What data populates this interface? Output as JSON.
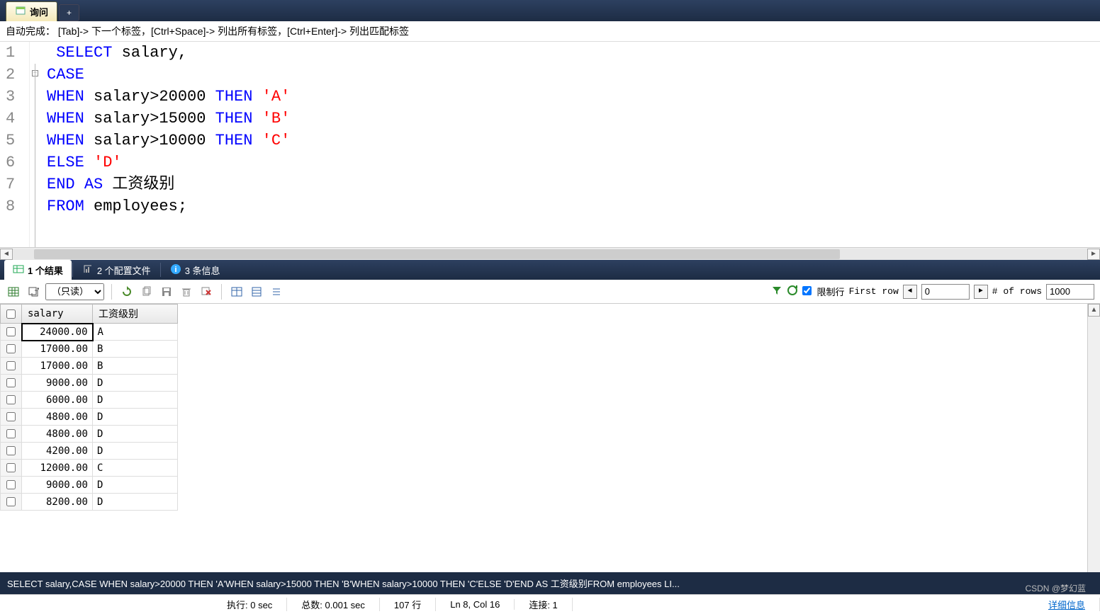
{
  "tabs": {
    "main": "询问",
    "plus": "+"
  },
  "hint": "自动完成：  [Tab]-> 下一个标签，[Ctrl+Space]-> 列出所有标签，[Ctrl+Enter]-> 列出匹配标签",
  "code": {
    "lines": [
      "1",
      "2",
      "3",
      "4",
      "5",
      "6",
      "7",
      "8"
    ],
    "tokens": [
      [
        {
          "t": "SELECT",
          "c": "kw"
        },
        {
          "t": " salary,",
          "c": "ident"
        }
      ],
      [
        {
          "t": "CASE",
          "c": "kw"
        }
      ],
      [
        {
          "t": "WHEN",
          "c": "kw"
        },
        {
          "t": " salary>20000 ",
          "c": "ident"
        },
        {
          "t": "THEN",
          "c": "kw"
        },
        {
          "t": " ",
          "c": "ident"
        },
        {
          "t": "'A'",
          "c": "str"
        }
      ],
      [
        {
          "t": "WHEN",
          "c": "kw"
        },
        {
          "t": " salary>15000 ",
          "c": "ident"
        },
        {
          "t": "THEN",
          "c": "kw"
        },
        {
          "t": " ",
          "c": "ident"
        },
        {
          "t": "'B'",
          "c": "str"
        }
      ],
      [
        {
          "t": "WHEN",
          "c": "kw"
        },
        {
          "t": " salary>10000 ",
          "c": "ident"
        },
        {
          "t": "THEN",
          "c": "kw"
        },
        {
          "t": " ",
          "c": "ident"
        },
        {
          "t": "'C'",
          "c": "str"
        }
      ],
      [
        {
          "t": "ELSE",
          "c": "kw"
        },
        {
          "t": " ",
          "c": "ident"
        },
        {
          "t": "'D'",
          "c": "str"
        }
      ],
      [
        {
          "t": "END",
          "c": "kw"
        },
        {
          "t": " ",
          "c": "ident"
        },
        {
          "t": "AS",
          "c": "kw"
        },
        {
          "t": " 工资级别",
          "c": "ident"
        }
      ],
      [
        {
          "t": "FROM",
          "c": "kw"
        },
        {
          "t": " employees;",
          "c": "ident"
        }
      ]
    ],
    "fold_symbol": "−"
  },
  "resultTabs": {
    "t1": "1 个结果",
    "t2": "2 个配置文件",
    "t3": "3 条信息"
  },
  "toolbar": {
    "readonly": "（只读）",
    "limit_label": "限制行",
    "first_row_label": "First row",
    "first_row_value": "0",
    "num_rows_label": "# of rows",
    "num_rows_value": "1000"
  },
  "grid": {
    "headers": [
      "salary",
      "工资级别"
    ],
    "rows": [
      [
        "24000.00",
        "A"
      ],
      [
        "17000.00",
        "B"
      ],
      [
        "17000.00",
        "B"
      ],
      [
        "9000.00",
        "D"
      ],
      [
        "6000.00",
        "D"
      ],
      [
        "4800.00",
        "D"
      ],
      [
        "4800.00",
        "D"
      ],
      [
        "4200.00",
        "D"
      ],
      [
        "12000.00",
        "C"
      ],
      [
        "9000.00",
        "D"
      ],
      [
        "8200.00",
        "D"
      ]
    ]
  },
  "sqlStatus": "SELECT salary,CASE WHEN salary>20000 THEN 'A'WHEN salary>15000 THEN 'B'WHEN salary>10000 THEN 'C'ELSE 'D'END AS 工资级别FROM employees LI...",
  "status": {
    "exec": "执行: 0 sec",
    "total": "总数: 0.001 sec",
    "rows": "107 行",
    "pos": "Ln 8, Col 16",
    "conn": "连接: 1",
    "detail": "详细信息"
  },
  "watermark": "CSDN @梦幻蓝"
}
